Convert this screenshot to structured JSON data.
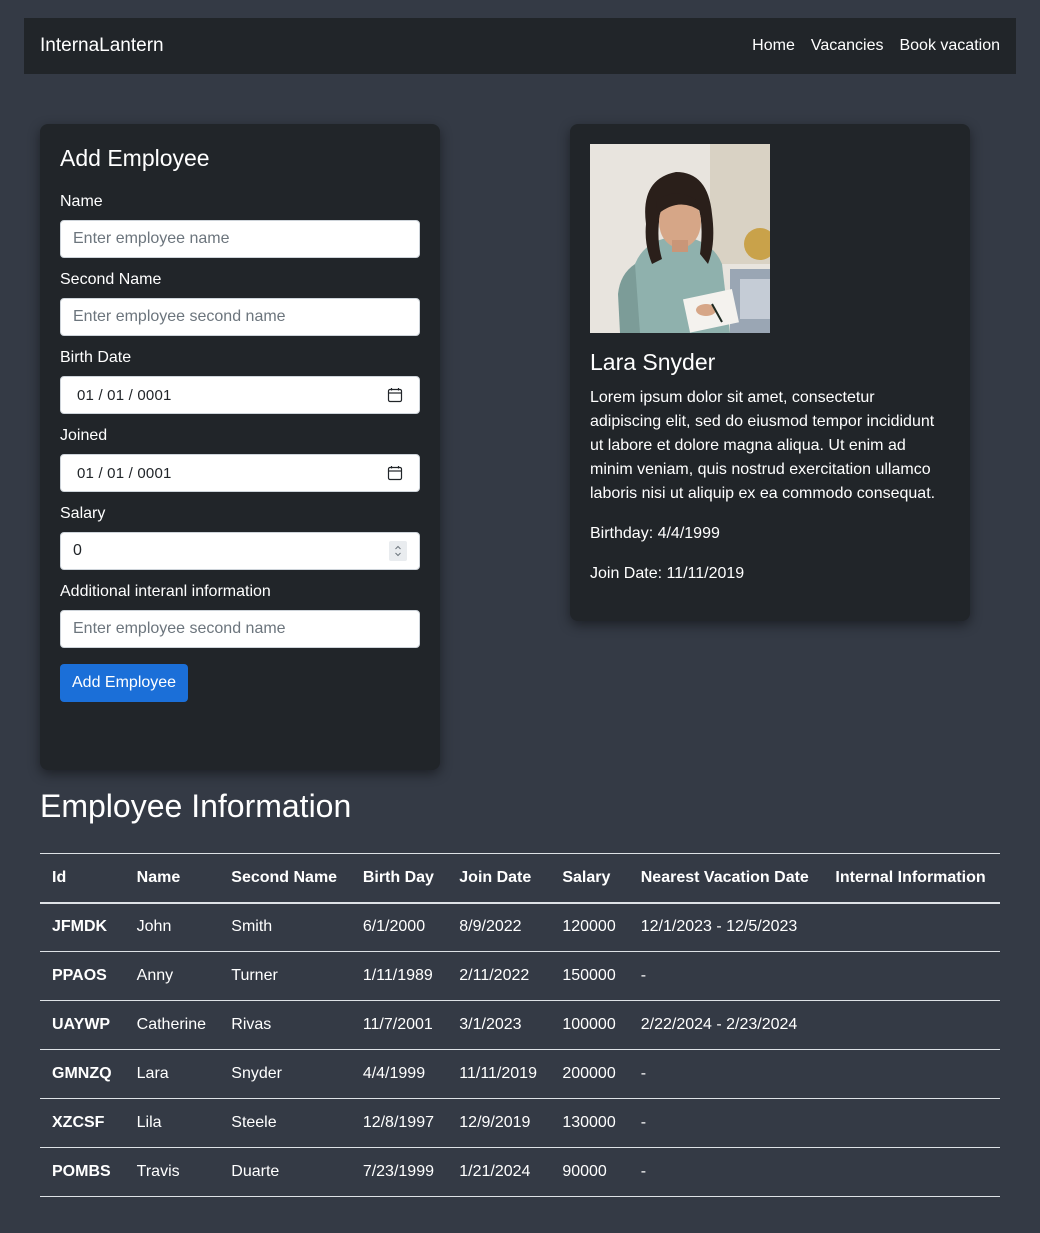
{
  "navbar": {
    "brand": "InternaLantern",
    "links": [
      "Home",
      "Vacancies",
      "Book vacation"
    ]
  },
  "form": {
    "title": "Add Employee",
    "name_label": "Name",
    "name_placeholder": "Enter employee name",
    "second_name_label": "Second Name",
    "second_name_placeholder": "Enter employee second name",
    "birth_date_label": "Birth Date",
    "birth_date_value": "01 / 01 / 0001",
    "joined_label": "Joined",
    "joined_value": "01 / 01 / 0001",
    "salary_label": "Salary",
    "salary_value": "0",
    "additional_label": "Additional interanl information",
    "additional_placeholder": "Enter employee second name",
    "submit_label": "Add Employee"
  },
  "profile": {
    "name": "Lara Snyder",
    "description": "Lorem ipsum dolor sit amet, consectetur adipiscing elit, sed do eiusmod tempor incididunt ut labore et dolore magna aliqua. Ut enim ad minim veniam, quis nostrud exercitation ullamco laboris nisi ut aliquip ex ea commodo consequat.",
    "birthday": "Birthday: 4/4/1999",
    "join_date": "Join Date: 11/11/2019"
  },
  "table": {
    "title": "Employee Information",
    "headers": [
      "Id",
      "Name",
      "Second Name",
      "Birth Day",
      "Join Date",
      "Salary",
      "Nearest Vacation Date",
      "Internal Information"
    ],
    "rows": [
      [
        "JFMDK",
        "John",
        "Smith",
        "6/1/2000",
        "8/9/2022",
        "120000",
        "12/1/2023 - 12/5/2023",
        ""
      ],
      [
        "PPAOS",
        "Anny",
        "Turner",
        "1/11/1989",
        "2/11/2022",
        "150000",
        "-",
        ""
      ],
      [
        "UAYWP",
        "Catherine",
        "Rivas",
        "11/7/2001",
        "3/1/2023",
        "100000",
        "2/22/2024 - 2/23/2024",
        ""
      ],
      [
        "GMNZQ",
        "Lara",
        "Snyder",
        "4/4/1999",
        "11/11/2019",
        "200000",
        "-",
        ""
      ],
      [
        "XZCSF",
        "Lila",
        "Steele",
        "12/8/1997",
        "12/9/2019",
        "130000",
        "-",
        ""
      ],
      [
        "POMBS",
        "Travis",
        "Duarte",
        "7/23/1999",
        "1/21/2024",
        "90000",
        "-",
        ""
      ]
    ]
  },
  "colors": {
    "page_background": "#343a45",
    "card_background": "#212529",
    "primary_button": "#1b6fd8"
  },
  "icons": {
    "date_picker": "calendar-icon",
    "number_spinner": "spinner-icon"
  }
}
